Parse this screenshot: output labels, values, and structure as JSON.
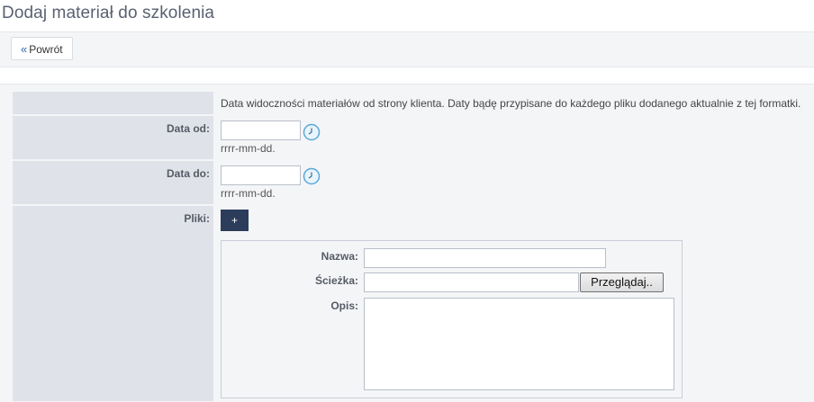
{
  "page": {
    "title": "Dodaj materiał do szkolenia"
  },
  "toolbar": {
    "back_chevron": "«",
    "back_label": "Powrót"
  },
  "form": {
    "info_text": "Data widoczności materiałów od strony klienta. Daty bądę przypisane do każdego pliku dodanego aktualnie z tej formatki.",
    "date_from": {
      "label": "Data od:",
      "value": "",
      "hint": "rrrr-mm-dd."
    },
    "date_to": {
      "label": "Data do:",
      "value": "",
      "hint": "rrrr-mm-dd."
    },
    "files": {
      "label": "Pliki:",
      "add_button_label": "+",
      "name_label": "Nazwa:",
      "name_value": "",
      "path_label": "Ścieżka:",
      "path_value": "",
      "browse_label": "Przeglądaj..",
      "description_label": "Opis:",
      "description_value": ""
    }
  },
  "icons": {
    "calendar_picker": "clock-icon"
  },
  "colors": {
    "label_background": "#dfe2e8",
    "form_background": "#f4f5f7",
    "add_button": "#2c3d5b",
    "title_text": "#5a6170"
  }
}
